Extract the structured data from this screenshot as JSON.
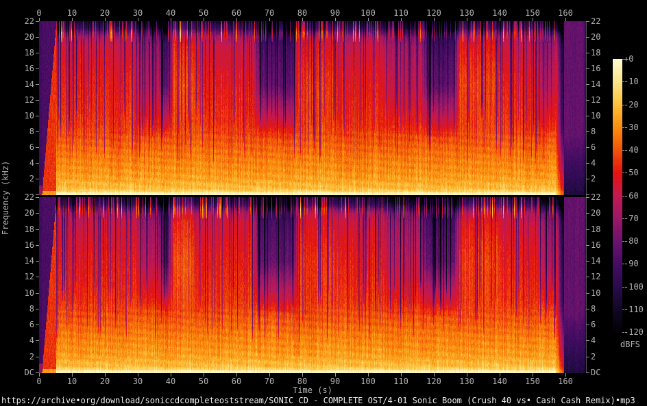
{
  "footer": {
    "url": "https://archive•org/download/soniccdcompleteoststream/SONIC CD - COMPLETE OST/4-01 Sonic Boom (Crush 40 vs• Cash Cash Remix)•mp3"
  },
  "chart_data": {
    "type": "heatmap",
    "subtype": "audio-spectrogram",
    "channels": [
      "left",
      "right"
    ],
    "title": "",
    "xlabel": "Time (s)",
    "ylabel": "Frequency (kHz)",
    "x_range_s": [
      0,
      166.25
    ],
    "y_range_khz": [
      0,
      22
    ],
    "grid": false,
    "time_ticks": [
      "0",
      "10",
      "20",
      "30",
      "40",
      "50",
      "60",
      "70",
      "80",
      "90",
      "100",
      "110",
      "120",
      "130",
      "140",
      "150",
      "160"
    ],
    "freq_ticks": [
      "22",
      "20",
      "18",
      "16",
      "14",
      "12",
      "10",
      "8",
      "6",
      "4",
      "2",
      "DC"
    ],
    "colorbar": {
      "label": "dBFS",
      "position": "right",
      "range_db": [
        0,
        -120
      ],
      "ticks": [
        "+0",
        "-10",
        "-20",
        "-30",
        "-40",
        "-50",
        "-60",
        "-70",
        "-80",
        "-90",
        "-100",
        "-110",
        "-120"
      ],
      "stops": [
        {
          "db": 0,
          "color": "#fcfcd4"
        },
        {
          "db": -10,
          "color": "#fbe48a"
        },
        {
          "db": -20,
          "color": "#fcc13c"
        },
        {
          "db": -30,
          "color": "#fb8d0c"
        },
        {
          "db": -40,
          "color": "#f0530a"
        },
        {
          "db": -50,
          "color": "#e51310"
        },
        {
          "db": -60,
          "color": "#c31950"
        },
        {
          "db": -70,
          "color": "#9a1868"
        },
        {
          "db": -80,
          "color": "#6b136d"
        },
        {
          "db": -90,
          "color": "#450c63"
        },
        {
          "db": -100,
          "color": "#290b4d"
        },
        {
          "db": -110,
          "color": "#100825"
        },
        {
          "db": -120,
          "color": "#020104"
        }
      ]
    },
    "freq_profile_db": [
      [
        0,
        -12
      ],
      [
        0.3,
        -13
      ],
      [
        0.8,
        -22
      ],
      [
        2,
        -26
      ],
      [
        3,
        -29
      ],
      [
        5,
        -34
      ],
      [
        7,
        -40
      ],
      [
        9,
        -45
      ],
      [
        12,
        -48
      ],
      [
        15,
        -51
      ],
      [
        17,
        -54
      ],
      [
        19,
        -58
      ],
      [
        20,
        -66
      ],
      [
        20.6,
        -80
      ],
      [
        21.2,
        -96
      ],
      [
        22,
        -107
      ]
    ],
    "sections": [
      {
        "t0": 0,
        "t1": 0.8,
        "kind": "flat"
      },
      {
        "t0": 0.8,
        "t1": 5.2,
        "kind": "intro"
      },
      {
        "t0": 5.2,
        "t1": 30,
        "kind": "loud",
        "hi": 0,
        "all": 0
      },
      {
        "t0": 30,
        "t1": 37,
        "kind": "loud",
        "hi": -6,
        "all": 0
      },
      {
        "t0": 37,
        "t1": 40,
        "kind": "loud",
        "hi": -14,
        "all": -2
      },
      {
        "t0": 40,
        "t1": 47,
        "kind": "loud",
        "hi": 4,
        "all": 0
      },
      {
        "t0": 47,
        "t1": 66,
        "kind": "loud",
        "hi": 0,
        "all": 0
      },
      {
        "t0": 66,
        "t1": 78,
        "kind": "loud",
        "hi": -13,
        "all": 0
      },
      {
        "t0": 78,
        "t1": 90,
        "kind": "loud",
        "hi": 2,
        "all": 0
      },
      {
        "t0": 90,
        "t1": 105,
        "kind": "loud",
        "hi": 0,
        "all": 0
      },
      {
        "t0": 105,
        "t1": 117,
        "kind": "loud",
        "hi": -4,
        "all": 0
      },
      {
        "t0": 117,
        "t1": 127,
        "kind": "loud",
        "hi": -13,
        "all": 0
      },
      {
        "t0": 127,
        "t1": 140,
        "kind": "loud",
        "hi": 3,
        "all": 0
      },
      {
        "t0": 140,
        "t1": 152,
        "kind": "loud",
        "hi": 0,
        "all": 0
      },
      {
        "t0": 152,
        "t1": 157,
        "kind": "loud",
        "hi": -6,
        "all": 0
      },
      {
        "t0": 157,
        "t1": 159.5,
        "kind": "fade"
      },
      {
        "t0": 159.5,
        "t1": 166.3,
        "kind": "outro"
      }
    ]
  }
}
